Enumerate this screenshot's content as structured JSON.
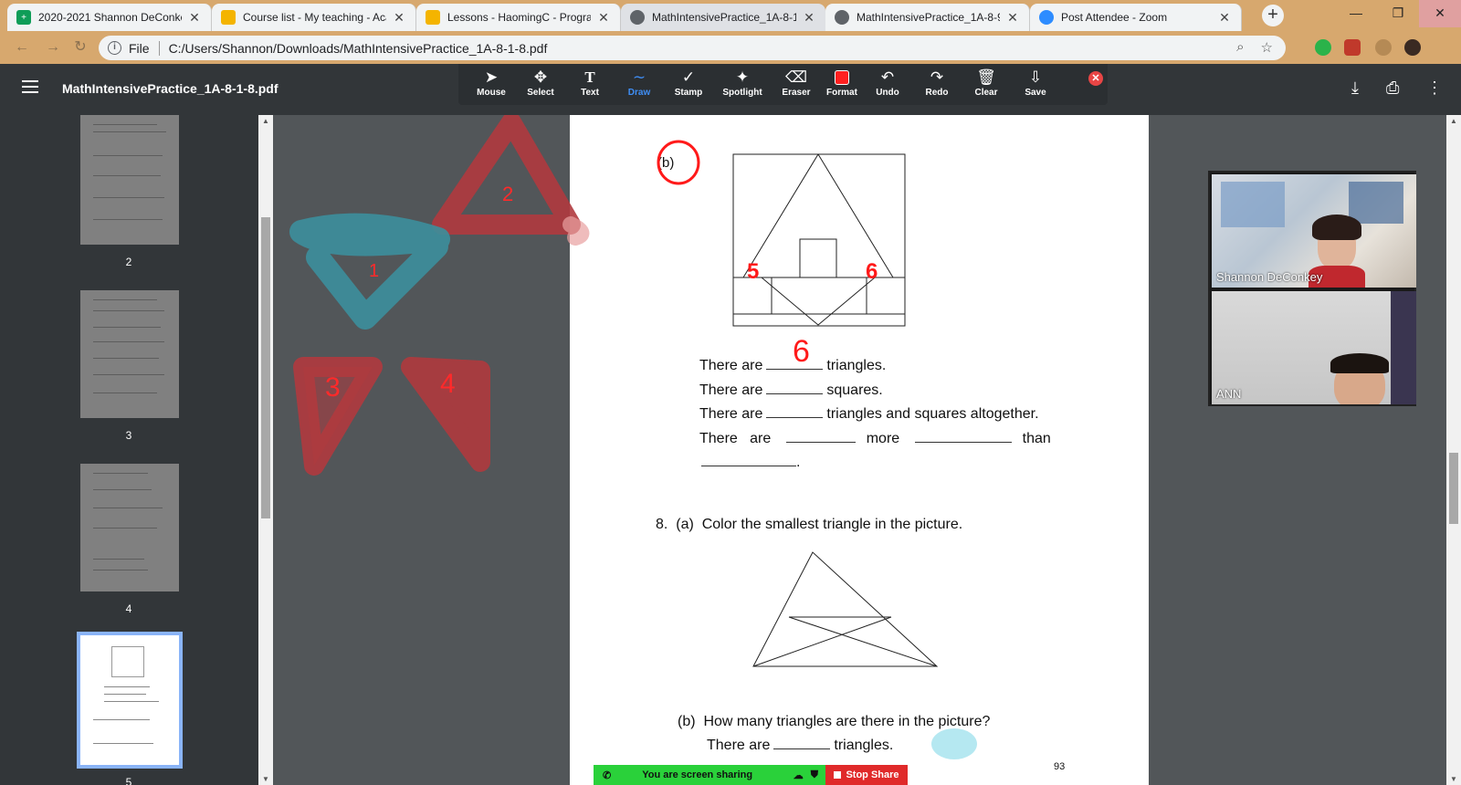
{
  "browser": {
    "tabs": [
      {
        "title": "2020-2021 Shannon DeConkey",
        "favicon_color": "#0f9d58",
        "favicon_glyph": "+"
      },
      {
        "title": "Course list - My teaching - Aca",
        "favicon_color": "#f4b400",
        "favicon_glyph": ""
      },
      {
        "title": "Lessons - HaomingC - Program",
        "favicon_color": "#f4b400",
        "favicon_glyph": ""
      },
      {
        "title": "MathIntensivePractice_1A-8-1-",
        "favicon_color": "#5f6368",
        "favicon_glyph": ""
      },
      {
        "title": "MathIntensivePractice_1A-8-9-",
        "favicon_color": "#5f6368",
        "favicon_glyph": ""
      },
      {
        "title": "Post Attendee - Zoom",
        "favicon_color": "#2d8cff",
        "favicon_glyph": ""
      }
    ],
    "address": {
      "scheme_label": "File",
      "url": "C:/Users/Shannon/Downloads/MathIntensivePractice_1A-8-1-8.pdf"
    }
  },
  "pdf_viewer": {
    "title": "MathIntensivePractice_1A-8-1-8.pdf",
    "thumbnails": [
      {
        "page": "2"
      },
      {
        "page": "3"
      },
      {
        "page": "4"
      },
      {
        "page": "5"
      }
    ]
  },
  "annotate_toolbar": {
    "tools": [
      {
        "label": "Mouse",
        "glyph": "➤"
      },
      {
        "label": "Select",
        "glyph": "✥"
      },
      {
        "label": "Text",
        "glyph": "T"
      },
      {
        "label": "Draw",
        "glyph": "∼"
      },
      {
        "label": "Stamp",
        "glyph": "✓"
      },
      {
        "label": "Spotlight",
        "glyph": "✦"
      },
      {
        "label": "Eraser",
        "glyph": "⌫"
      },
      {
        "label": "Format",
        "glyph": ""
      },
      {
        "label": "Undo",
        "glyph": "↶"
      },
      {
        "label": "Redo",
        "glyph": "↷"
      },
      {
        "label": "Clear",
        "glyph": "🗑"
      },
      {
        "label": "Save",
        "glyph": "⇩"
      }
    ],
    "active_tool": "Draw"
  },
  "document": {
    "part_b_label": "(b)",
    "line1_pre": "There are",
    "line1_answer": "6",
    "line1_post": "triangles.",
    "line2_pre": "There are",
    "line2_post": "squares.",
    "line3_pre": "There are",
    "line3_post": "triangles and squares altogether.",
    "line4_a": "There",
    "line4_b": "are",
    "line4_c": "more",
    "line4_d": "than",
    "line5_end": ".",
    "q8_number": "8.",
    "q8_a_label": "(a)",
    "q8_a_text": "Color the smallest triangle in the picture.",
    "q8_b_label": "(b)",
    "q8_b_text": "How many triangles are there in the picture?",
    "q8_b_line_pre": "There are",
    "q8_b_line_post": "triangles.",
    "page_number": "93",
    "annot_numbers": [
      "1",
      "2",
      "3",
      "4",
      "5",
      "6"
    ]
  },
  "video": {
    "participants": [
      {
        "name": "Shannon DeConkey"
      },
      {
        "name": "ANN"
      }
    ]
  },
  "share_bar": {
    "status": "You are screen sharing",
    "stop_label": "Stop Share"
  },
  "colors": {
    "annot_red": "#b03a3e",
    "annot_teal": "#3c8f9c",
    "ink_red": "#ff1a1a",
    "share_green": "#2ad13a",
    "stop_red": "#e02a2a"
  }
}
